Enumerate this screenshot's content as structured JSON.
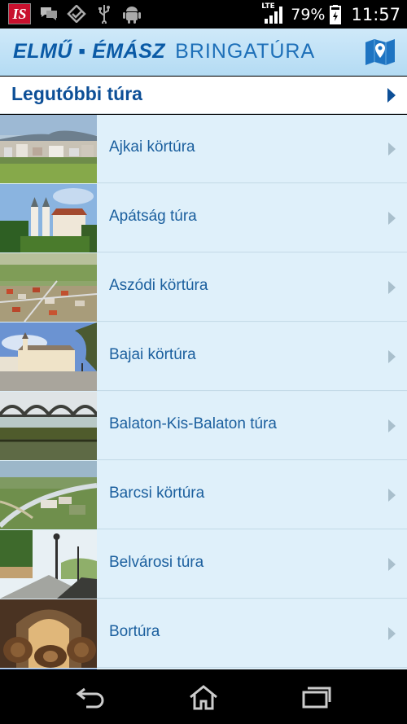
{
  "status_bar": {
    "app_badge": "IS",
    "network_label": "LTE",
    "battery_percent": "79%",
    "time": "11:57",
    "icons": [
      "chat-icon",
      "check-icon",
      "usb-icon",
      "android-icon",
      "signal-icon",
      "battery-icon"
    ]
  },
  "action_bar": {
    "brand_main": "ELMŰ ▪ ÉMÁSZ",
    "brand_sub": "BRINGATÚRA",
    "map_icon": "map-icon",
    "brand_color": "#0a5aa6"
  },
  "last_tour": {
    "label": "Legutóbbi túra"
  },
  "tours": [
    {
      "label": "Ajkai körtúra",
      "thumb": "town-with-hill"
    },
    {
      "label": "Apátság túra",
      "thumb": "abbey"
    },
    {
      "label": "Aszódi körtúra",
      "thumb": "aerial-town"
    },
    {
      "label": "Bajai körtúra",
      "thumb": "town-square"
    },
    {
      "label": "Balaton-Kis-Balaton túra",
      "thumb": "bridge-over-river"
    },
    {
      "label": "Barcsi körtúra",
      "thumb": "aerial-river"
    },
    {
      "label": "Belvárosi túra",
      "thumb": "promenade"
    },
    {
      "label": "Bortúra",
      "thumb": "wine-cellar"
    }
  ],
  "nav_bar": {
    "icons": [
      "back-icon",
      "home-icon",
      "recent-apps-icon"
    ]
  }
}
